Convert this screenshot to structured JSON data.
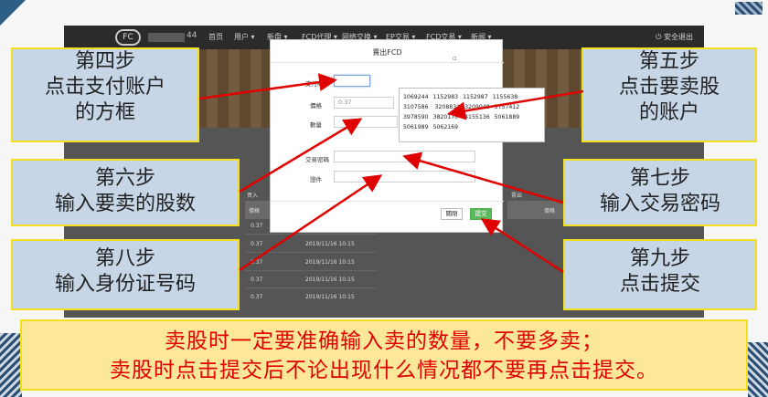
{
  "navbar": {
    "user_suffix": "44",
    "items": [
      "首页",
      "用户 ▾",
      "新盘 ▾",
      "FCD代理 ▾",
      "网络交换 ▾",
      "EP交易 ▾",
      "FCD交易 ▾",
      "新闻 ▾"
    ],
    "logout": "⏻ 安全退出"
  },
  "modal": {
    "title": "賣出FCD",
    "fields": {
      "payment_account_label": "支付賬戶",
      "price_label": "價格",
      "price_value": "0.37",
      "quantity_label": "數量",
      "trade_password_label": "交易密碼",
      "id_label": "證件"
    },
    "accounts": [
      "1069244",
      "1152983",
      "1152987",
      "1155638",
      "3107586",
      "3208831",
      "3209048",
      "3757412",
      "3978590",
      "3820170",
      "4155136",
      "5061889",
      "5061989",
      "5062169"
    ],
    "close_label": "關閉",
    "submit_label": "提交"
  },
  "table": {
    "left_header": "買入",
    "left_col_price": "價格",
    "right_header": "賣出",
    "right_col_price": "價格",
    "rows": [
      {
        "price": "0.37",
        "time": ""
      },
      {
        "price": "0.37",
        "time": "2019/11/16 10:15"
      },
      {
        "price": "0.37",
        "time": "2019/11/16 10:15"
      },
      {
        "price": "0.37",
        "time": "2019/11/16 10:15"
      },
      {
        "price": "0.37",
        "time": "2019/11/16 10:15"
      }
    ]
  },
  "callouts": {
    "step4": [
      "第四步",
      "点击支付账户",
      "的方框"
    ],
    "step5": [
      "第五步",
      "点击要卖股",
      "的账户"
    ],
    "step6": [
      "第六步",
      "输入要卖的股数"
    ],
    "step7": [
      "第七步",
      "输入交易密码"
    ],
    "step8": [
      "第八步",
      "输入身份证号码"
    ],
    "step9": [
      "第九步",
      "点击提交"
    ]
  },
  "warning": {
    "line1": "卖股时一定要准确输入卖的数量，不要多卖；",
    "line2": "卖股时点击提交后不论出现什么情况都不要再点击提交。"
  },
  "colors": {
    "callout_bg": "#c7d6e6",
    "callout_border": "#f0e020",
    "arrow": "#e00000",
    "warning_text": "#e00000",
    "submit_button": "#5cb85c"
  }
}
